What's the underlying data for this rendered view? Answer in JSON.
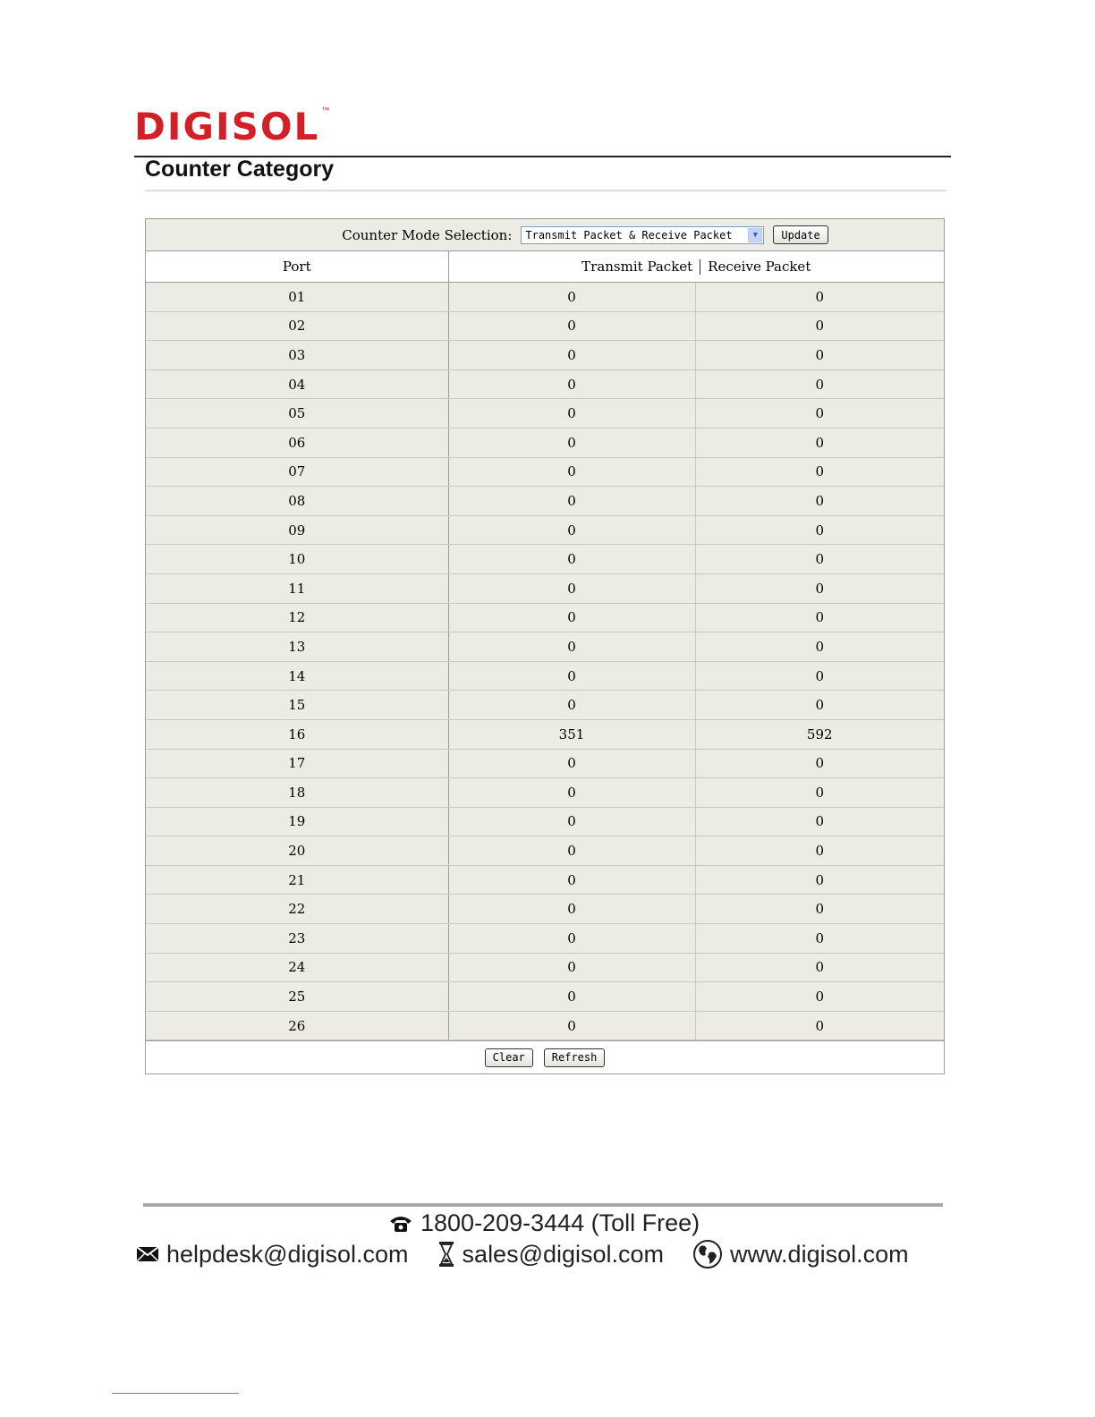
{
  "brand": {
    "logo_text": "DIGISOL",
    "trademark": "™"
  },
  "page": {
    "title": "Counter Category"
  },
  "counter_mode": {
    "label": "Counter Mode Selection:",
    "selected": "Transmit Packet & Receive Packet",
    "update_label": "Update"
  },
  "table": {
    "headers": {
      "port": "Port",
      "transmit": "Transmit Packet",
      "receive": "Receive Packet"
    },
    "rows": [
      {
        "port": "01",
        "tx": "0",
        "rx": "0"
      },
      {
        "port": "02",
        "tx": "0",
        "rx": "0"
      },
      {
        "port": "03",
        "tx": "0",
        "rx": "0"
      },
      {
        "port": "04",
        "tx": "0",
        "rx": "0"
      },
      {
        "port": "05",
        "tx": "0",
        "rx": "0"
      },
      {
        "port": "06",
        "tx": "0",
        "rx": "0"
      },
      {
        "port": "07",
        "tx": "0",
        "rx": "0"
      },
      {
        "port": "08",
        "tx": "0",
        "rx": "0"
      },
      {
        "port": "09",
        "tx": "0",
        "rx": "0"
      },
      {
        "port": "10",
        "tx": "0",
        "rx": "0"
      },
      {
        "port": "11",
        "tx": "0",
        "rx": "0"
      },
      {
        "port": "12",
        "tx": "0",
        "rx": "0"
      },
      {
        "port": "13",
        "tx": "0",
        "rx": "0"
      },
      {
        "port": "14",
        "tx": "0",
        "rx": "0"
      },
      {
        "port": "15",
        "tx": "0",
        "rx": "0"
      },
      {
        "port": "16",
        "tx": "351",
        "rx": "592"
      },
      {
        "port": "17",
        "tx": "0",
        "rx": "0"
      },
      {
        "port": "18",
        "tx": "0",
        "rx": "0"
      },
      {
        "port": "19",
        "tx": "0",
        "rx": "0"
      },
      {
        "port": "20",
        "tx": "0",
        "rx": "0"
      },
      {
        "port": "21",
        "tx": "0",
        "rx": "0"
      },
      {
        "port": "22",
        "tx": "0",
        "rx": "0"
      },
      {
        "port": "23",
        "tx": "0",
        "rx": "0"
      },
      {
        "port": "24",
        "tx": "0",
        "rx": "0"
      },
      {
        "port": "25",
        "tx": "0",
        "rx": "0"
      },
      {
        "port": "26",
        "tx": "0",
        "rx": "0"
      }
    ]
  },
  "actions": {
    "clear_label": "Clear",
    "refresh_label": "Refresh"
  },
  "footer": {
    "phone": "1800-209-3444 (Toll Free)",
    "helpdesk_email": "helpdesk@digisol.com",
    "sales_email": "sales@digisol.com",
    "website": "www.digisol.com"
  },
  "colors": {
    "brand_red": "#d32027",
    "table_cell_bg": "#ecece4"
  },
  "icons": [
    "phone-icon",
    "mail-icon",
    "hourglass-icon",
    "globe-icon",
    "chevron-down-icon"
  ]
}
